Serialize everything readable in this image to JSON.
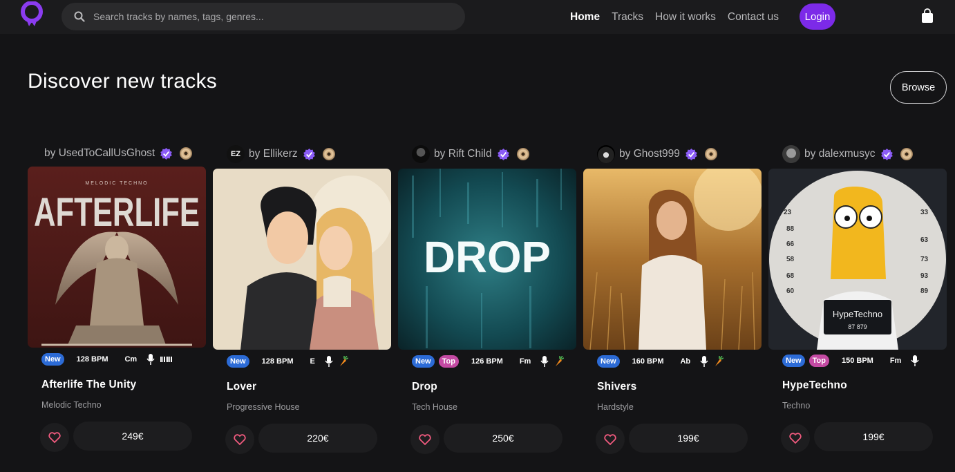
{
  "nav": {
    "search_placeholder": "Search tracks by names, tags, genres...",
    "links": [
      "Home",
      "Tracks",
      "How it works",
      "Contact us"
    ],
    "login_label": "Login"
  },
  "page": {
    "title": "Discover new tracks",
    "browse_label": "Browse"
  },
  "colors": {
    "accent": "#7c2ae8",
    "new_badge": "#2c6bd6",
    "top_badge": "#c44aa3",
    "verified": "#8b5cf6"
  },
  "cards": [
    {
      "by": "by",
      "artist": "UsedToCallUsGhost",
      "cover_text": "AFTERLIFE",
      "cover_subtext": "MELODIC TECHNO",
      "badges": [
        "New"
      ],
      "bpm": "128 BPM",
      "key": "Cm",
      "title": "Afterlife The Unity",
      "genre": "Melodic Techno",
      "price": "249€"
    },
    {
      "by": "by",
      "artist": "Ellikerz",
      "avatar_text": "EZ",
      "badges": [
        "New"
      ],
      "bpm": "128 BPM",
      "key": "E",
      "title": "Lover",
      "genre": "Progressive House",
      "price": "220€"
    },
    {
      "by": "by",
      "artist": "Rift Child",
      "cover_text": "DROP",
      "badges": [
        "New",
        "Top"
      ],
      "bpm": "126 BPM",
      "key": "Fm",
      "title": "Drop",
      "genre": "Tech House",
      "price": "250€"
    },
    {
      "by": "by",
      "artist": "Ghost999",
      "badges": [
        "New"
      ],
      "bpm": "160 BPM",
      "key": "Ab",
      "title": "Shivers",
      "genre": "Hardstyle",
      "price": "199€"
    },
    {
      "by": "by",
      "artist": "dalexmusyc",
      "cover_text": "HypeTechno",
      "cover_subtext": "87 879",
      "cover_numbers": [
        "23",
        "88",
        "66",
        "58",
        "68",
        "60",
        "33",
        "63",
        "73",
        "93",
        "89"
      ],
      "badges": [
        "New",
        "Top"
      ],
      "bpm": "150 BPM",
      "key": "Fm",
      "title": "HypeTechno",
      "genre": "Techno",
      "price": "199€"
    }
  ]
}
